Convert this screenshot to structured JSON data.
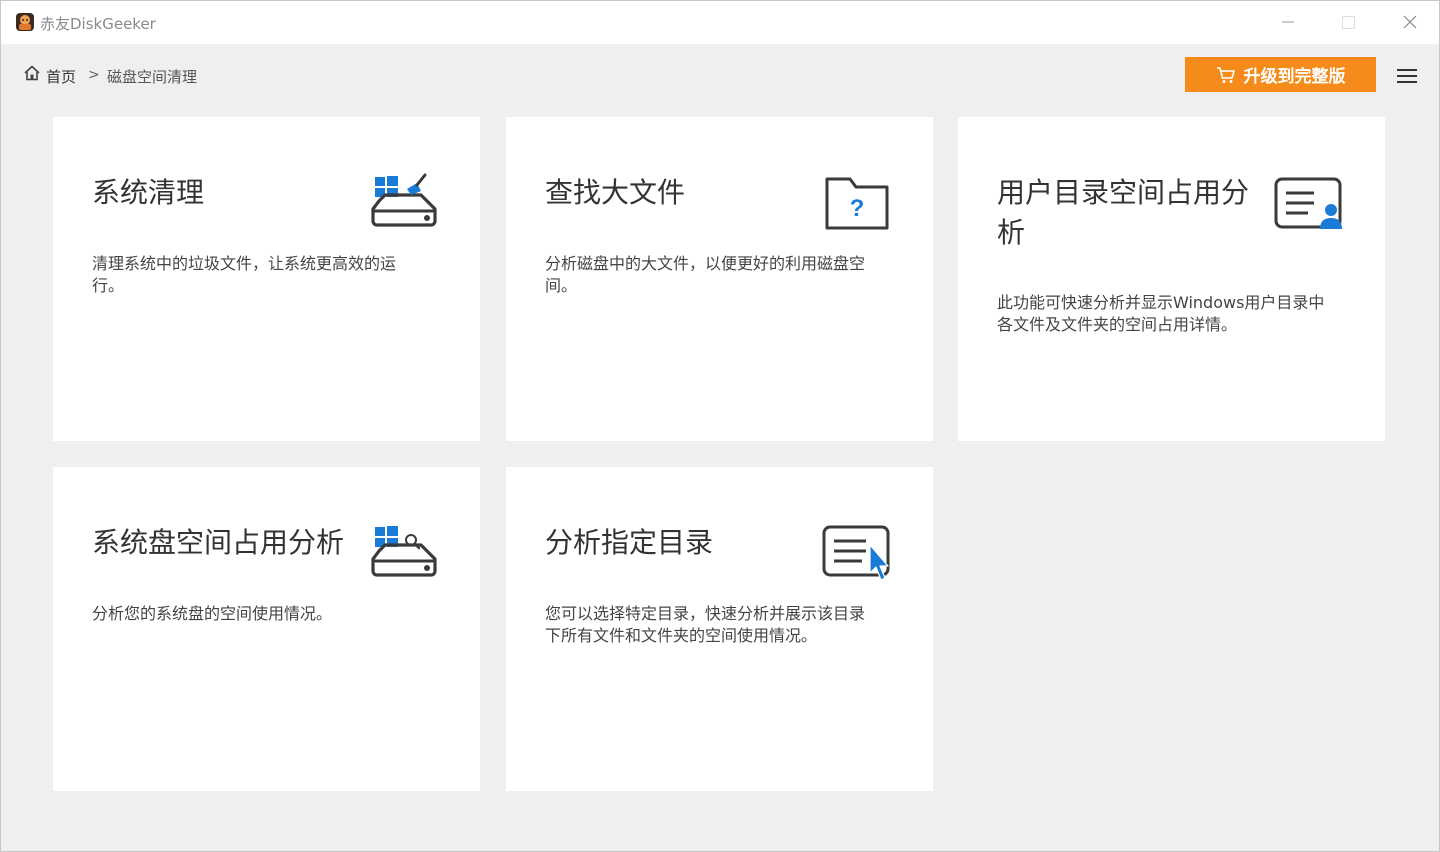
{
  "app": {
    "title": "赤友DiskGeeker"
  },
  "breadcrumb": {
    "home_label": "首页",
    "separator": ">",
    "current": "磁盘空间清理"
  },
  "header": {
    "upgrade_label": "升级到完整版"
  },
  "colors": {
    "accent_orange": "#f58b1a",
    "icon_blue": "#1a7bd6",
    "icon_dark": "#3a3a3a"
  },
  "cards": [
    {
      "title": "系统清理",
      "description_lines": [
        "清理系统中的垃圾文件，让系统更高效的运",
        "行。"
      ],
      "icon": "disk-clean-icon"
    },
    {
      "title": "查找大文件",
      "description_lines": [
        "分析磁盘中的大文件，以便更好的利用磁盘空",
        "间。"
      ],
      "icon": "folder-question-icon"
    },
    {
      "title_lines": [
        "用户目录空间占用分",
        "析"
      ],
      "description_lines": [
        "此功能可快速分析并显示Windows用户目录中",
        "各文件及文件夹的空间占用详情。"
      ],
      "icon": "user-directory-icon"
    },
    {
      "title": "系统盘空间占用分析",
      "description_lines": [
        "分析您的系统盘的空间使用情况。"
      ],
      "icon": "disk-search-icon"
    },
    {
      "title": "分析指定目录",
      "description_lines": [
        "您可以选择特定目录，快速分析并展示该目录",
        "下所有文件和文件夹的空间使用情况。"
      ],
      "icon": "list-cursor-icon"
    }
  ]
}
